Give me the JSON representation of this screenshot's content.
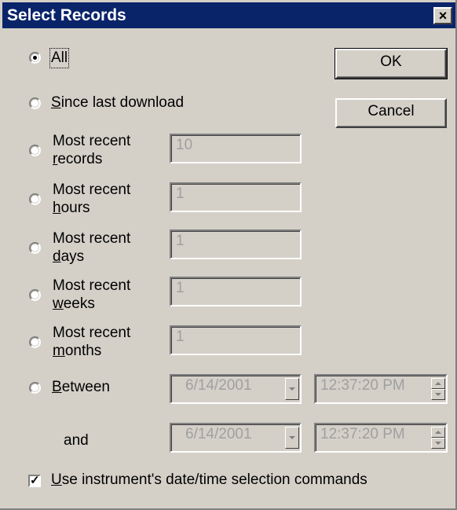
{
  "window": {
    "title": "Select Records",
    "close_glyph": "×"
  },
  "buttons": {
    "ok": "OK",
    "cancel": "Cancel"
  },
  "options": {
    "all": {
      "label": "All",
      "selected": true
    },
    "since_last": {
      "prefix": "S",
      "rest": "ince last download"
    },
    "records": {
      "line1": "Most recent",
      "mn": "r",
      "rest": "ecords",
      "value": "10"
    },
    "hours": {
      "line1": "Most recent",
      "mn": "h",
      "rest": "ours",
      "value": "1"
    },
    "days": {
      "line1": "Most recent",
      "mn": "d",
      "rest": "ays",
      "value": "1"
    },
    "weeks": {
      "line1": "Most recent",
      "mn": "w",
      "rest": "eeks",
      "value": "1"
    },
    "months": {
      "line1": "Most recent",
      "mn": "m",
      "rest": "onths",
      "value": "1"
    },
    "between": {
      "mn": "B",
      "rest": "etween",
      "date": "6/14/2001",
      "time": "12:37:20 PM"
    },
    "and": {
      "label": "and",
      "date": "6/14/2001",
      "time": "12:37:20 PM"
    }
  },
  "checkbox": {
    "mn": "U",
    "rest": "se instrument's date/time selection commands",
    "checked": true,
    "glyph": "✓"
  }
}
